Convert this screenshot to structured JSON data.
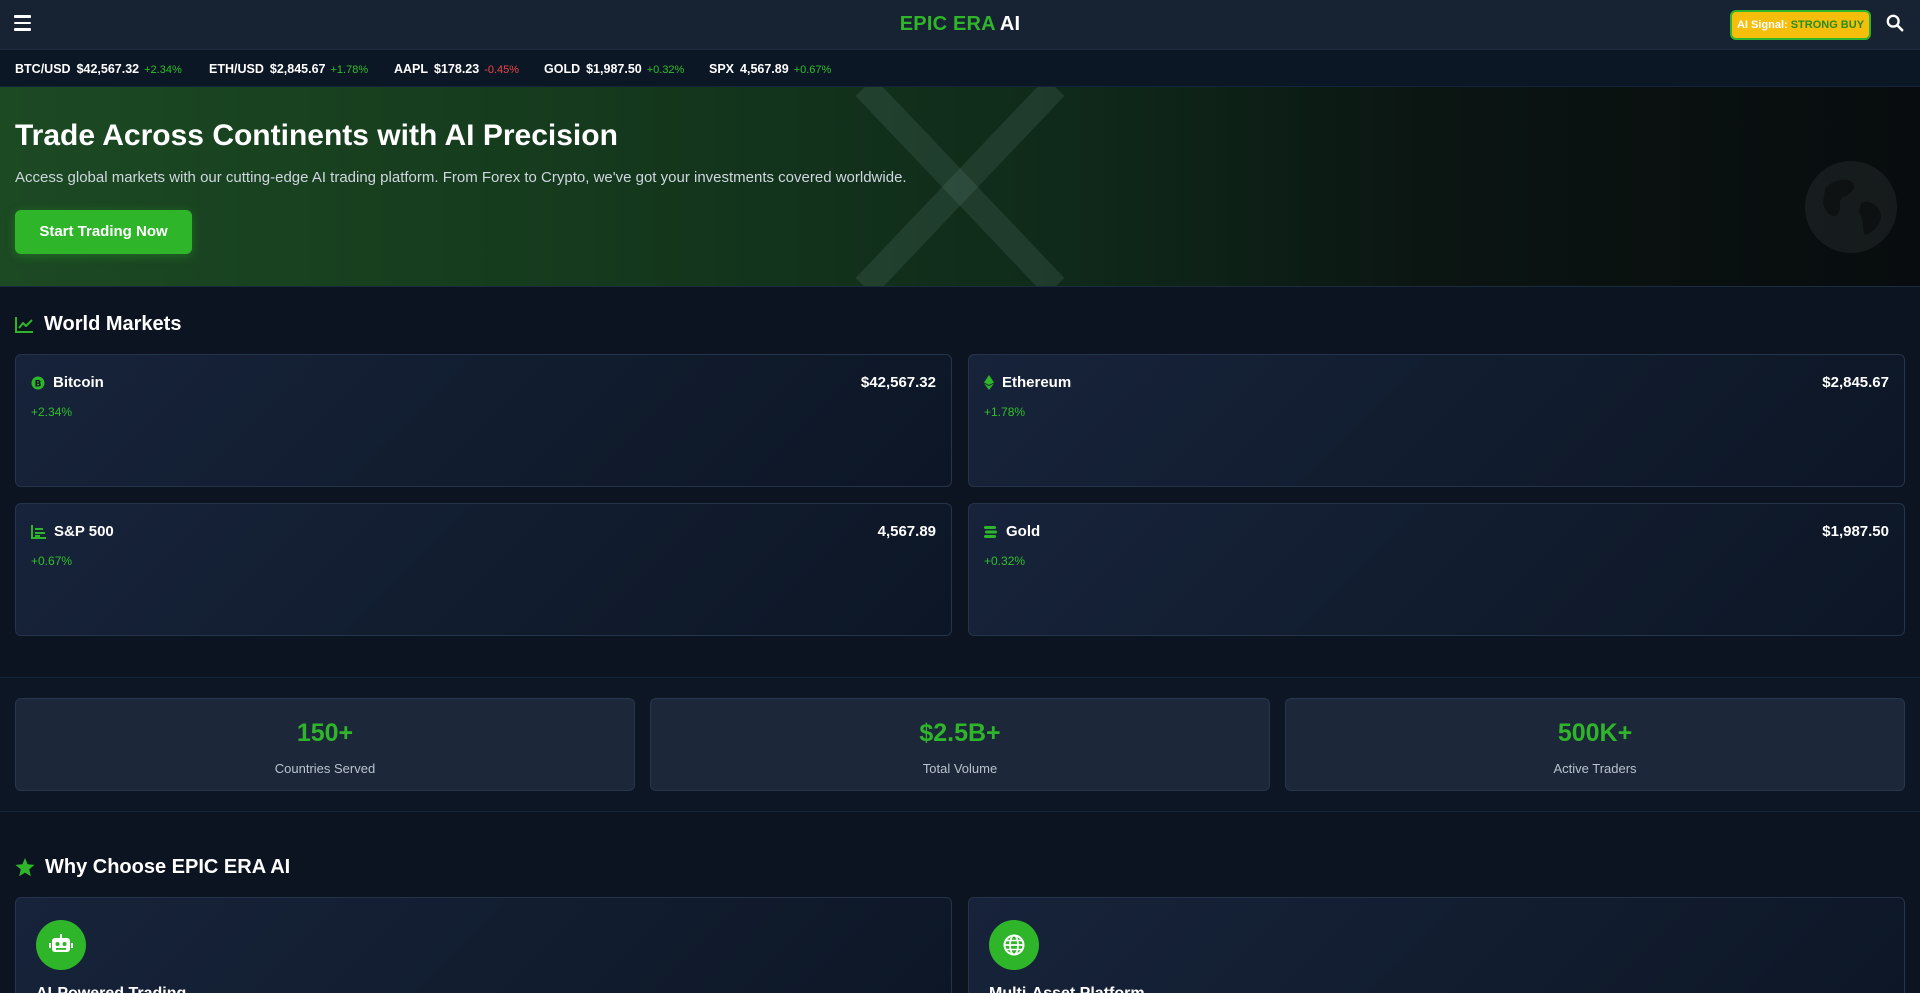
{
  "header": {
    "brand_primary": "EPIC ERA",
    "brand_secondary": "AI",
    "signal_label": "AI Signal:",
    "signal_value": "STRONG BUY",
    "menu_icon": "hamburger-icon",
    "search_icon": "search-icon"
  },
  "ticker": [
    {
      "symbol": "BTC/USD",
      "price": "$42,567.32",
      "change": "+2.34%",
      "direction": "up"
    },
    {
      "symbol": "ETH/USD",
      "price": "$2,845.67",
      "change": "+1.78%",
      "direction": "up"
    },
    {
      "symbol": "AAPL",
      "price": "$178.23",
      "change": "-0.45%",
      "direction": "down"
    },
    {
      "symbol": "GOLD",
      "price": "$1,987.50",
      "change": "+0.32%",
      "direction": "up"
    },
    {
      "symbol": "SPX",
      "price": "4,567.89",
      "change": "+0.67%",
      "direction": "up"
    }
  ],
  "hero": {
    "title": "Trade Across Continents with AI Precision",
    "subtitle": "Access global markets with our cutting-edge AI trading platform. From Forex to Crypto, we've got your investments covered worldwide.",
    "cta_label": "Start Trading Now"
  },
  "markets": {
    "title": "World Markets",
    "cards": [
      {
        "name": "Bitcoin",
        "price": "$42,567.32",
        "change": "+2.34%",
        "icon": "bitcoin-icon"
      },
      {
        "name": "Ethereum",
        "price": "$2,845.67",
        "change": "+1.78%",
        "icon": "ethereum-icon"
      },
      {
        "name": "S&P 500",
        "price": "4,567.89",
        "change": "+0.67%",
        "icon": "chart-bar-icon"
      },
      {
        "name": "Gold",
        "price": "$1,987.50",
        "change": "+0.32%",
        "icon": "coins-icon"
      }
    ]
  },
  "stats": [
    {
      "value": "150+",
      "label": "Countries Served"
    },
    {
      "value": "$2.5B+",
      "label": "Total Volume"
    },
    {
      "value": "500K+",
      "label": "Active Traders"
    }
  ],
  "features": {
    "title": "Why Choose EPIC ERA AI",
    "cards": [
      {
        "title": "AI-Powered Trading",
        "icon": "robot-icon"
      },
      {
        "title": "Multi-Asset Platform",
        "icon": "globe-icon"
      }
    ]
  },
  "colors": {
    "accent": "#2fb52a",
    "signal": "#f5be0b",
    "down": "#ef4444",
    "background": "#0d1421"
  }
}
